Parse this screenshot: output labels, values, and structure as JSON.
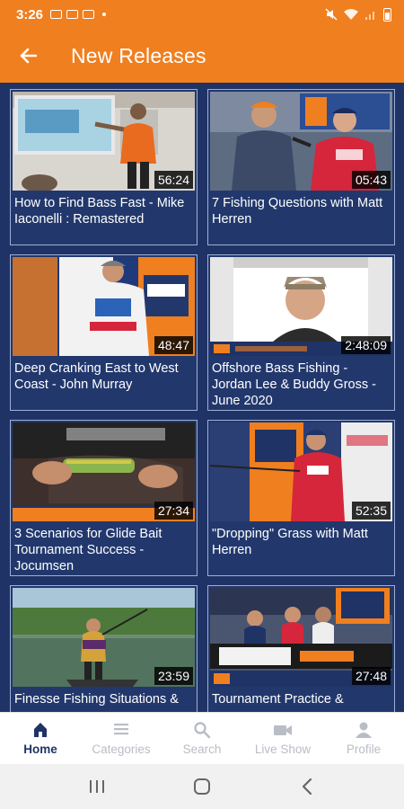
{
  "status_bar": {
    "time": "3:26"
  },
  "header": {
    "title": "New Releases"
  },
  "videos": [
    {
      "title": "How to Find Bass Fast - Mike Iaconelli : Remastered",
      "duration": "56:24"
    },
    {
      "title": "7 Fishing Questions with Matt Herren",
      "duration": "05:43"
    },
    {
      "title": "Deep Cranking East to West Coast - John Murray",
      "duration": "48:47"
    },
    {
      "title": "Offshore Bass Fishing - Jordan Lee & Buddy Gross - June 2020",
      "duration": "2:48:09"
    },
    {
      "title": "3 Scenarios for Glide Bait Tournament Success - Jocumsen",
      "duration": "27:34"
    },
    {
      "title": "\"Dropping\" Grass with Matt Herren",
      "duration": "52:35"
    },
    {
      "title": "Finesse Fishing Situations &",
      "duration": "23:59"
    },
    {
      "title": "Tournament Practice &",
      "duration": "27:48"
    }
  ],
  "nav": {
    "items": [
      {
        "label": "Home",
        "icon": "home-icon",
        "active": true
      },
      {
        "label": "Categories",
        "icon": "list-icon",
        "active": false
      },
      {
        "label": "Search",
        "icon": "search-icon",
        "active": false
      },
      {
        "label": "Live Show",
        "icon": "video-camera-icon",
        "active": false
      },
      {
        "label": "Profile",
        "icon": "person-icon",
        "active": false
      }
    ]
  },
  "colors": {
    "accent": "#f07f1f",
    "background": "#1f3366",
    "card_border": "#9db0d6"
  }
}
